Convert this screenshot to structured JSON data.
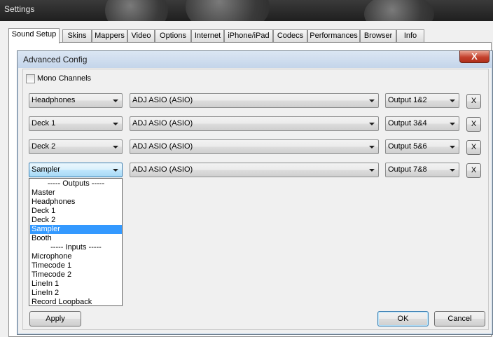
{
  "window": {
    "title": "Settings"
  },
  "tabs": [
    {
      "label": "Sound Setup",
      "active": true
    },
    {
      "label": "Skins"
    },
    {
      "label": "Mappers"
    },
    {
      "label": "Video"
    },
    {
      "label": "Options"
    },
    {
      "label": "Internet"
    },
    {
      "label": "iPhone/iPad"
    },
    {
      "label": "Codecs"
    },
    {
      "label": "Performances"
    },
    {
      "label": "Browser"
    },
    {
      "label": "Info"
    }
  ],
  "dialog": {
    "title": "Advanced Config",
    "close_label": "X",
    "mono_channels": {
      "label": "Mono Channels",
      "checked": false
    },
    "rows": [
      {
        "channel": "Headphones",
        "device": "ADJ ASIO (ASIO)",
        "output": "Output 1&2",
        "remove_label": "X"
      },
      {
        "channel": "Deck 1",
        "device": "ADJ ASIO (ASIO)",
        "output": "Output 3&4",
        "remove_label": "X"
      },
      {
        "channel": "Deck 2",
        "device": "ADJ ASIO (ASIO)",
        "output": "Output 5&6",
        "remove_label": "X"
      },
      {
        "channel": "Sampler",
        "device": "ADJ ASIO (ASIO)",
        "output": "Output 7&8",
        "remove_label": "X"
      }
    ],
    "dropdown_options": [
      {
        "label": "----- Outputs -----",
        "header": true
      },
      {
        "label": "Master"
      },
      {
        "label": "Headphones"
      },
      {
        "label": "Deck 1"
      },
      {
        "label": "Deck 2"
      },
      {
        "label": "Sampler",
        "selected": true
      },
      {
        "label": "Booth"
      },
      {
        "label": "----- Inputs -----",
        "header": true
      },
      {
        "label": "Microphone"
      },
      {
        "label": "Timecode 1"
      },
      {
        "label": "Timecode 2"
      },
      {
        "label": "LineIn 1"
      },
      {
        "label": "LineIn 2"
      },
      {
        "label": "Record Loopback"
      }
    ],
    "buttons": {
      "apply": "Apply",
      "ok": "OK",
      "cancel": "Cancel"
    }
  },
  "colors": {
    "selection": "#3399ff",
    "close_button": "#c4402c"
  }
}
